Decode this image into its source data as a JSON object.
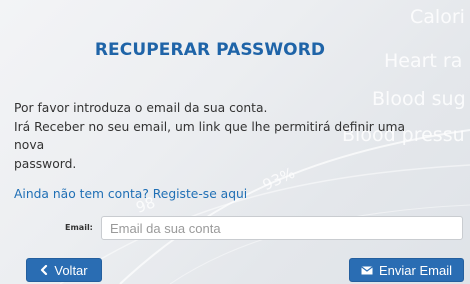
{
  "background": {
    "words": [
      "Calori",
      "Heart ra",
      "Blood sug",
      "Blood pressu"
    ],
    "numbers": [
      "93%",
      "98"
    ]
  },
  "form": {
    "title": "RECUPERAR PASSWORD",
    "description_line1": "Por favor introduza o email da sua conta.",
    "description_line2": "Irá Receber no seu email, um link que lhe permitirá definir uma nova",
    "description_line3": "password.",
    "register_link": "Ainda não tem conta? Registe-se aqui",
    "email_label": "Email:",
    "email_placeholder": "Email da sua conta",
    "email_value": ""
  },
  "buttons": {
    "back_label": "Voltar",
    "back_icon": "chevron-left-icon",
    "send_label": "Enviar Email",
    "send_icon": "envelope-icon"
  },
  "colors": {
    "accent": "#2a6db3",
    "title": "#1f64a8",
    "link": "#1f6fb5"
  }
}
